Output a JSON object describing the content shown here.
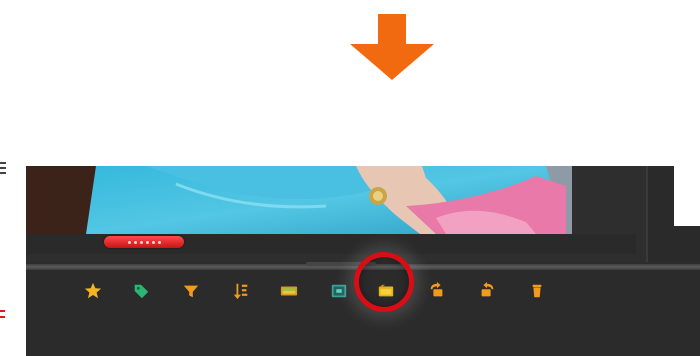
{
  "callout": {
    "arrow_color": "#f26a0f",
    "ring_color": "#d80e14",
    "highlighted_tool": "create-slideshow-icon"
  },
  "preview": {
    "scrub_indicator_color": "#e82a2a"
  },
  "toolbar": {
    "icon_color": "#f39a1c",
    "tools": [
      "star-icon",
      "tag-icon",
      "filter-icon",
      "sort-icon",
      "media-tray-icon",
      "image-frame-icon",
      "create-slideshow-icon",
      "rotate-left-icon",
      "rotate-right-icon",
      "trash-icon"
    ]
  }
}
